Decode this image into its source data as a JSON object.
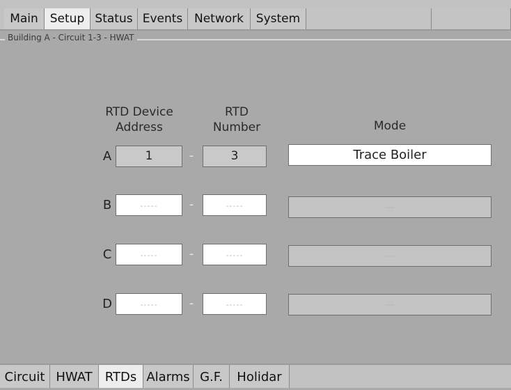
{
  "top_tabs": {
    "main": "Main",
    "setup": "Setup",
    "status": "Status",
    "events": "Events",
    "network": "Network",
    "system": "System"
  },
  "group_title": "Building A - Circuit 1-3 - HWAT",
  "headers": {
    "rtd_device_address_1": "RTD Device",
    "rtd_device_address_2": "Address",
    "rtd_number_1": "RTD",
    "rtd_number_2": "Number",
    "mode": "Mode"
  },
  "rows": [
    {
      "letter": "A",
      "address": "1",
      "number": "3",
      "separator": "-",
      "mode": "Trace Boiler"
    },
    {
      "letter": "B",
      "address": "-----",
      "number": "-----",
      "separator": "-",
      "mode": "---"
    },
    {
      "letter": "C",
      "address": "-----",
      "number": "-----",
      "separator": "-",
      "mode": "---"
    },
    {
      "letter": "D",
      "address": "-----",
      "number": "-----",
      "separator": "-",
      "mode": "---"
    }
  ],
  "bottom_tabs": {
    "circuit": "Circuit",
    "hwat": "HWAT",
    "rtds": "RTDs",
    "alarms": "Alarms",
    "gf": "G.F.",
    "holiday": "Holidar"
  }
}
